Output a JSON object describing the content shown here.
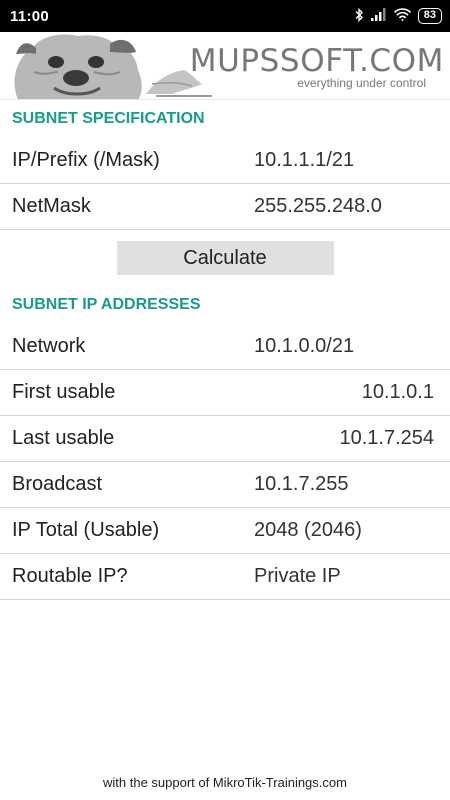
{
  "status_bar": {
    "time": "11:00",
    "battery": "83"
  },
  "banner": {
    "brand": "MUPSSOFT.COM",
    "tagline": "everything under control"
  },
  "spec": {
    "header": "SUBNET SPECIFICATION",
    "ip_label": "IP/Prefix (/Mask)",
    "ip_value": "10.1.1.1/21",
    "mask_label": "NetMask",
    "mask_value": "255.255.248.0"
  },
  "calculate_label": "Calculate",
  "addresses": {
    "header": "SUBNET IP ADDRESSES",
    "rows": [
      {
        "label": "Network",
        "value": "10.1.0.0/21"
      },
      {
        "label": "First usable",
        "value": "10.1.0.1"
      },
      {
        "label": "Last usable",
        "value": "10.1.7.254"
      },
      {
        "label": "Broadcast",
        "value": "10.1.7.255"
      },
      {
        "label": "IP Total (Usable)",
        "value": "2048 (2046)"
      },
      {
        "label": "Routable IP?",
        "value": "Private IP"
      }
    ]
  },
  "footer": "with the support of MikroTik-Trainings.com",
  "icons": [
    "bluetooth-icon",
    "signal-icon",
    "wifi-icon",
    "battery-icon",
    "dog-logo-icon"
  ],
  "colors": {
    "accent": "#1a9a88",
    "status_bar": "#000000",
    "button": "#e0e0e0"
  }
}
